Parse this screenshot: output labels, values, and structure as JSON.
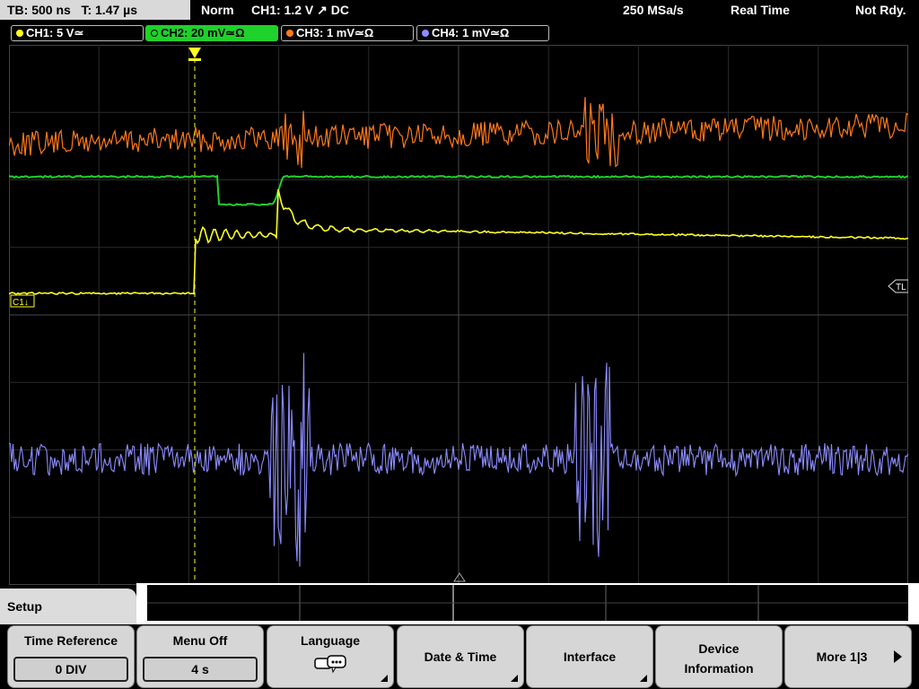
{
  "topbar": {
    "timebase": "TB: 500 ns   T: 1.47 µs",
    "mode": "Norm",
    "trigger": "CH1: 1.2 V ↗ DC",
    "sample_rate": "250 MSa/s",
    "acq": "Real Time",
    "status": "Not Rdy."
  },
  "channels": [
    {
      "label": "CH1: 5 V≃",
      "color": "#ffff22"
    },
    {
      "label": "CH2: 20 mV≃Ω",
      "color": "#1fd12b",
      "active": true
    },
    {
      "label": "CH3: 1 mV≃Ω",
      "color": "#ff7a1a"
    },
    {
      "label": "CH4: 1 mV≃Ω",
      "color": "#8c8cff"
    }
  ],
  "markers": {
    "ch1_marker": "C1↓",
    "trigger_level": "TL"
  },
  "menu": {
    "title": "Setup",
    "softkeys": [
      {
        "label": "Time Reference",
        "value": "0 DIV"
      },
      {
        "label": "Menu Off",
        "value": "4 s"
      },
      {
        "label": "Language",
        "value": ""
      },
      {
        "label": "Date & Time",
        "value": ""
      },
      {
        "label": "Interface",
        "value": ""
      },
      {
        "label": "Device\nInformation",
        "value": ""
      },
      {
        "label": "More 1|3",
        "value": ""
      }
    ]
  }
}
